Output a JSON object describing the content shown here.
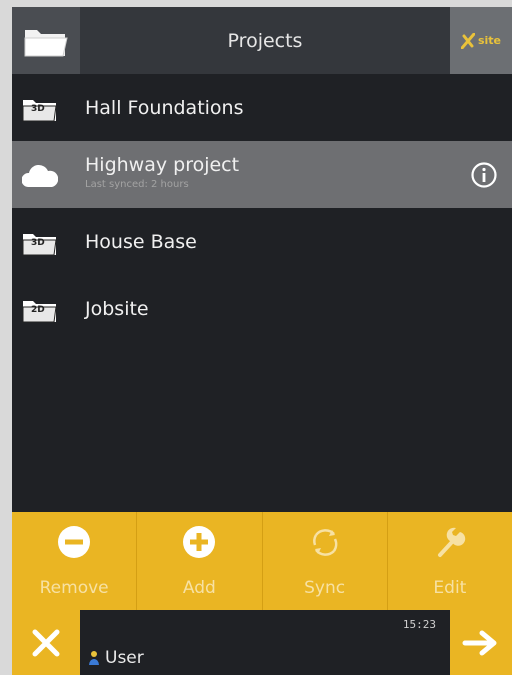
{
  "header": {
    "title": "Projects",
    "logo_text": "site",
    "folder_icon": "folder-open-icon"
  },
  "projects": [
    {
      "name": "Hall Foundations",
      "icon": "folder-3d-icon",
      "badge": "3D",
      "subtitle": ""
    },
    {
      "name": "Highway project",
      "icon": "cloud-icon",
      "badge": "",
      "subtitle": "Last synced: 2 hours",
      "selected": true
    },
    {
      "name": "House Base",
      "icon": "folder-3d-icon",
      "badge": "3D",
      "subtitle": ""
    },
    {
      "name": "Jobsite",
      "icon": "folder-2d-icon",
      "badge": "2D",
      "subtitle": ""
    }
  ],
  "toolbar": {
    "remove_label": "Remove",
    "add_label": "Add",
    "sync_label": "Sync",
    "edit_label": "Edit"
  },
  "status": {
    "time": "15:23",
    "user_label": "User"
  },
  "colors": {
    "accent": "#eab523",
    "background": "#1f2125",
    "selected_row": "#6e6f72",
    "header": "#34373c"
  }
}
